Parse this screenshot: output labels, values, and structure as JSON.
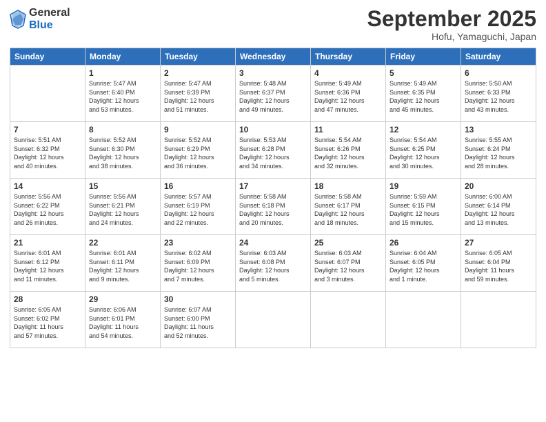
{
  "header": {
    "logo_general": "General",
    "logo_blue": "Blue",
    "month_title": "September 2025",
    "location": "Hofu, Yamaguchi, Japan"
  },
  "days_of_week": [
    "Sunday",
    "Monday",
    "Tuesday",
    "Wednesday",
    "Thursday",
    "Friday",
    "Saturday"
  ],
  "weeks": [
    [
      {
        "day": "",
        "info": ""
      },
      {
        "day": "1",
        "info": "Sunrise: 5:47 AM\nSunset: 6:40 PM\nDaylight: 12 hours\nand 53 minutes."
      },
      {
        "day": "2",
        "info": "Sunrise: 5:47 AM\nSunset: 6:39 PM\nDaylight: 12 hours\nand 51 minutes."
      },
      {
        "day": "3",
        "info": "Sunrise: 5:48 AM\nSunset: 6:37 PM\nDaylight: 12 hours\nand 49 minutes."
      },
      {
        "day": "4",
        "info": "Sunrise: 5:49 AM\nSunset: 6:36 PM\nDaylight: 12 hours\nand 47 minutes."
      },
      {
        "day": "5",
        "info": "Sunrise: 5:49 AM\nSunset: 6:35 PM\nDaylight: 12 hours\nand 45 minutes."
      },
      {
        "day": "6",
        "info": "Sunrise: 5:50 AM\nSunset: 6:33 PM\nDaylight: 12 hours\nand 43 minutes."
      }
    ],
    [
      {
        "day": "7",
        "info": "Sunrise: 5:51 AM\nSunset: 6:32 PM\nDaylight: 12 hours\nand 40 minutes."
      },
      {
        "day": "8",
        "info": "Sunrise: 5:52 AM\nSunset: 6:30 PM\nDaylight: 12 hours\nand 38 minutes."
      },
      {
        "day": "9",
        "info": "Sunrise: 5:52 AM\nSunset: 6:29 PM\nDaylight: 12 hours\nand 36 minutes."
      },
      {
        "day": "10",
        "info": "Sunrise: 5:53 AM\nSunset: 6:28 PM\nDaylight: 12 hours\nand 34 minutes."
      },
      {
        "day": "11",
        "info": "Sunrise: 5:54 AM\nSunset: 6:26 PM\nDaylight: 12 hours\nand 32 minutes."
      },
      {
        "day": "12",
        "info": "Sunrise: 5:54 AM\nSunset: 6:25 PM\nDaylight: 12 hours\nand 30 minutes."
      },
      {
        "day": "13",
        "info": "Sunrise: 5:55 AM\nSunset: 6:24 PM\nDaylight: 12 hours\nand 28 minutes."
      }
    ],
    [
      {
        "day": "14",
        "info": "Sunrise: 5:56 AM\nSunset: 6:22 PM\nDaylight: 12 hours\nand 26 minutes."
      },
      {
        "day": "15",
        "info": "Sunrise: 5:56 AM\nSunset: 6:21 PM\nDaylight: 12 hours\nand 24 minutes."
      },
      {
        "day": "16",
        "info": "Sunrise: 5:57 AM\nSunset: 6:19 PM\nDaylight: 12 hours\nand 22 minutes."
      },
      {
        "day": "17",
        "info": "Sunrise: 5:58 AM\nSunset: 6:18 PM\nDaylight: 12 hours\nand 20 minutes."
      },
      {
        "day": "18",
        "info": "Sunrise: 5:58 AM\nSunset: 6:17 PM\nDaylight: 12 hours\nand 18 minutes."
      },
      {
        "day": "19",
        "info": "Sunrise: 5:59 AM\nSunset: 6:15 PM\nDaylight: 12 hours\nand 15 minutes."
      },
      {
        "day": "20",
        "info": "Sunrise: 6:00 AM\nSunset: 6:14 PM\nDaylight: 12 hours\nand 13 minutes."
      }
    ],
    [
      {
        "day": "21",
        "info": "Sunrise: 6:01 AM\nSunset: 6:12 PM\nDaylight: 12 hours\nand 11 minutes."
      },
      {
        "day": "22",
        "info": "Sunrise: 6:01 AM\nSunset: 6:11 PM\nDaylight: 12 hours\nand 9 minutes."
      },
      {
        "day": "23",
        "info": "Sunrise: 6:02 AM\nSunset: 6:09 PM\nDaylight: 12 hours\nand 7 minutes."
      },
      {
        "day": "24",
        "info": "Sunrise: 6:03 AM\nSunset: 6:08 PM\nDaylight: 12 hours\nand 5 minutes."
      },
      {
        "day": "25",
        "info": "Sunrise: 6:03 AM\nSunset: 6:07 PM\nDaylight: 12 hours\nand 3 minutes."
      },
      {
        "day": "26",
        "info": "Sunrise: 6:04 AM\nSunset: 6:05 PM\nDaylight: 12 hours\nand 1 minute."
      },
      {
        "day": "27",
        "info": "Sunrise: 6:05 AM\nSunset: 6:04 PM\nDaylight: 11 hours\nand 59 minutes."
      }
    ],
    [
      {
        "day": "28",
        "info": "Sunrise: 6:05 AM\nSunset: 6:02 PM\nDaylight: 11 hours\nand 57 minutes."
      },
      {
        "day": "29",
        "info": "Sunrise: 6:06 AM\nSunset: 6:01 PM\nDaylight: 11 hours\nand 54 minutes."
      },
      {
        "day": "30",
        "info": "Sunrise: 6:07 AM\nSunset: 6:00 PM\nDaylight: 11 hours\nand 52 minutes."
      },
      {
        "day": "",
        "info": ""
      },
      {
        "day": "",
        "info": ""
      },
      {
        "day": "",
        "info": ""
      },
      {
        "day": "",
        "info": ""
      }
    ]
  ]
}
